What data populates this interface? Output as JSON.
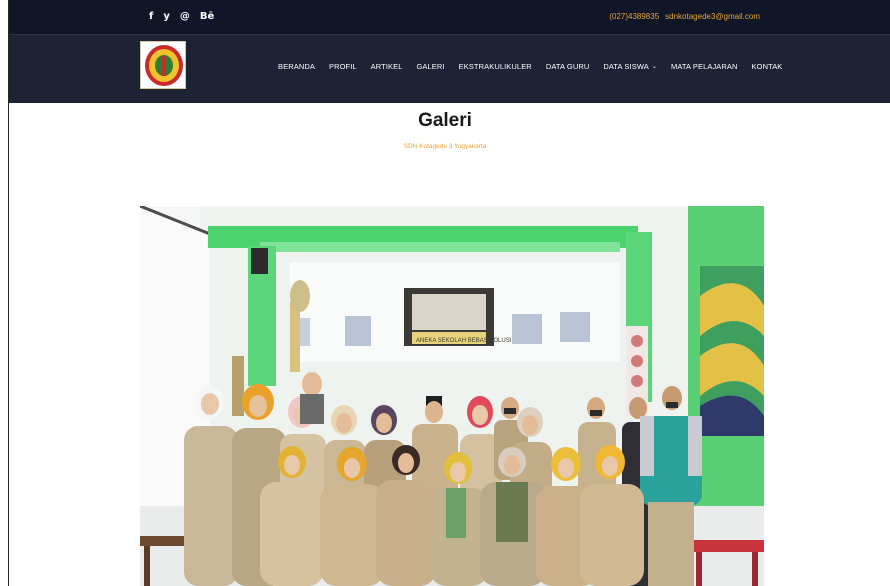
{
  "topbar": {
    "social": [
      {
        "glyph": "f",
        "icon": "facebook-icon"
      },
      {
        "glyph": "y",
        "icon": "twitter-icon"
      },
      {
        "glyph": "@",
        "icon": "instagram-icon"
      },
      {
        "glyph": "Bē",
        "icon": "behance-icon"
      }
    ],
    "phone": "(027)4389835",
    "email": "sdnkotagede3@gmail.com"
  },
  "nav": {
    "items": [
      "BERANDA",
      "PROFIL",
      "ARTIKEL",
      "GALERI",
      "EKSTRAKULIKULER",
      "DATA GURU",
      "DATA SISWA",
      "MATA PELAJARAN",
      "KONTAK"
    ],
    "dropdown_glyph": "⌄"
  },
  "page": {
    "title": "Galeri",
    "subtitle": "SDN Kotagede 3 Yogyakarta"
  },
  "photo": {
    "banner_text": "ANEKA SEKOLAH BEBAS POLUSI"
  },
  "colors": {
    "topbar_bg": "#111528",
    "navbar_bg": "#1d2235",
    "accent": "#e3a63a"
  }
}
